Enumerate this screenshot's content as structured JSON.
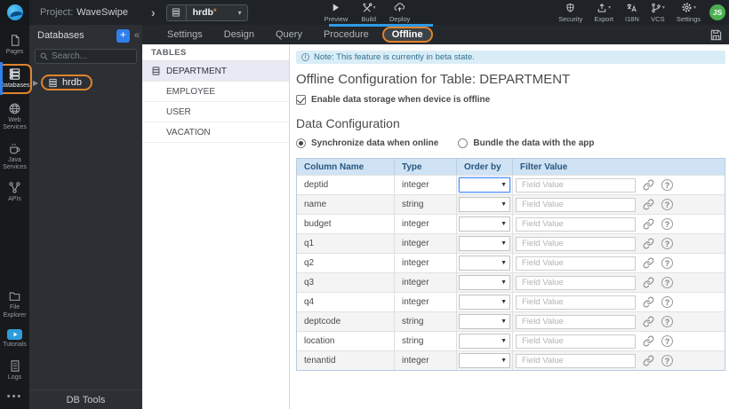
{
  "colors": {
    "accent_orange": "#e0832b",
    "primary_blue": "#2f80ed",
    "progress_blue": "#2e9be6",
    "note_bg": "#d9edf7",
    "note_text": "#31708f",
    "grid_header_bg": "#cfe3f5",
    "grid_header_text": "#29567c",
    "avatar_green": "#4caf50",
    "selected_table_bg": "#e9e8f5",
    "focused_select_border": "#4d90fe"
  },
  "topbar": {
    "project_label": "Project:",
    "project_name": "WaveSwipe",
    "breadcrumb_chevron": "›",
    "db_selector": {
      "value": "hrdb",
      "modified_marker": "*"
    },
    "actions": [
      {
        "label": "Preview"
      },
      {
        "label": "Build"
      },
      {
        "label": "Deploy"
      }
    ],
    "right_actions": [
      {
        "label": "Security"
      },
      {
        "label": "Export"
      },
      {
        "label": "I18N"
      },
      {
        "label": "VCS"
      },
      {
        "label": "Settings"
      }
    ],
    "avatar": "JS"
  },
  "sidebar": {
    "items": [
      {
        "label": "Pages"
      },
      {
        "label": "Databases",
        "selected": true
      },
      {
        "label": "Web Services"
      },
      {
        "label": "Java Services"
      },
      {
        "label": "APIs"
      },
      {
        "label": "File Explorer"
      },
      {
        "label": "Tutorials"
      },
      {
        "label": "Logs"
      }
    ],
    "more": "•••"
  },
  "db_panel": {
    "title": "Databases",
    "add_button": "+",
    "collapse": "«",
    "search_placeholder": "Search...",
    "tree": [
      {
        "label": "hrdb",
        "highlighted": true
      }
    ],
    "footer": "DB Tools"
  },
  "tabs": {
    "items": [
      {
        "label": "Settings"
      },
      {
        "label": "Design"
      },
      {
        "label": "Query"
      },
      {
        "label": "Procedure"
      },
      {
        "label": "Offline",
        "active": true
      }
    ]
  },
  "tables_panel": {
    "header": "TABLES",
    "items": [
      {
        "label": "DEPARTMENT",
        "selected": true
      },
      {
        "label": "EMPLOYEE"
      },
      {
        "label": "USER"
      },
      {
        "label": "VACATION"
      }
    ]
  },
  "offline": {
    "note": "Note: This feature is currently in beta state.",
    "title": "Offline Configuration for Table: DEPARTMENT",
    "enable_checkbox": {
      "label": "Enable data storage when device is offline",
      "checked": true
    },
    "section_title": "Data Configuration",
    "radios": [
      {
        "label": "Synchronize data when online",
        "selected": true
      },
      {
        "label": "Bundle the data with the app",
        "selected": false
      }
    ],
    "grid": {
      "headers": [
        "Column Name",
        "Type",
        "Order by",
        "Filter Value"
      ],
      "filter_placeholder": "Field Value",
      "rows": [
        {
          "name": "deptid",
          "type": "integer",
          "focused": true
        },
        {
          "name": "name",
          "type": "string"
        },
        {
          "name": "budget",
          "type": "integer"
        },
        {
          "name": "q1",
          "type": "integer"
        },
        {
          "name": "q2",
          "type": "integer"
        },
        {
          "name": "q3",
          "type": "integer"
        },
        {
          "name": "q4",
          "type": "integer"
        },
        {
          "name": "deptcode",
          "type": "string"
        },
        {
          "name": "location",
          "type": "string"
        },
        {
          "name": "tenantid",
          "type": "integer"
        }
      ]
    }
  }
}
